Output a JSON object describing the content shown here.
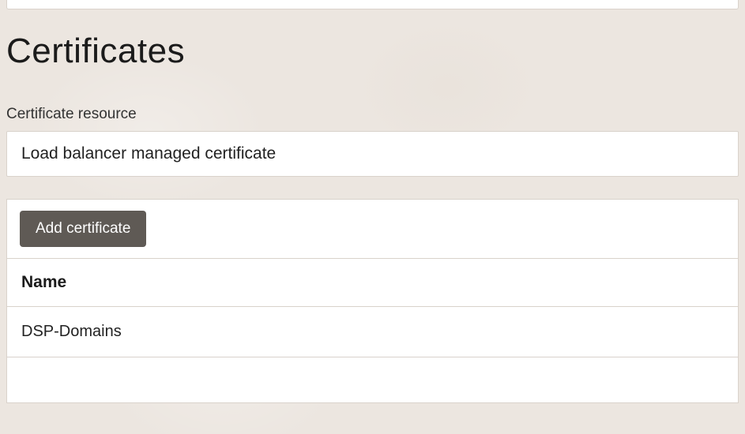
{
  "page": {
    "title": "Certificates"
  },
  "certificate_resource": {
    "label": "Certificate resource",
    "selected": "Load balancer managed certificate"
  },
  "certificates_table": {
    "add_button_label": "Add certificate",
    "columns": {
      "name": "Name"
    },
    "rows": [
      {
        "name": "DSP-Domains"
      }
    ]
  }
}
